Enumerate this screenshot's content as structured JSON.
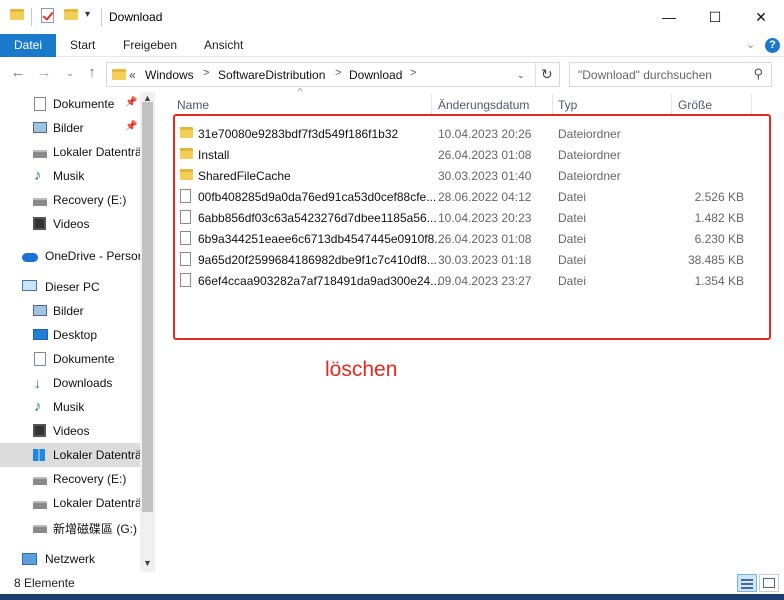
{
  "window": {
    "title": "Download",
    "controls": {
      "minimize": "—",
      "maximize": "☐",
      "close": "✕"
    }
  },
  "ribbon": {
    "tabs": [
      "Datei",
      "Start",
      "Freigeben",
      "Ansicht"
    ],
    "active_tab": "Datei"
  },
  "address": {
    "prefix": "«",
    "crumbs": [
      "Windows",
      "SoftwareDistribution",
      "Download"
    ],
    "separator": ">",
    "refresh": "↻"
  },
  "search": {
    "placeholder": "\"Download\" durchsuchen"
  },
  "sidebar": {
    "items": [
      {
        "label": "Dokumente",
        "icon": "document-icon",
        "pinned": true
      },
      {
        "label": "Bilder",
        "icon": "pictures-icon",
        "pinned": true
      },
      {
        "label": "Lokaler Datenträ",
        "icon": "drive-icon"
      },
      {
        "label": "Musik",
        "icon": "music-icon"
      },
      {
        "label": "Recovery (E:)",
        "icon": "drive-icon"
      },
      {
        "label": "Videos",
        "icon": "video-icon"
      },
      {
        "label": "OneDrive - Persor",
        "icon": "onedrive-icon"
      },
      {
        "label": "Dieser PC",
        "icon": "pc-icon"
      },
      {
        "label": "Bilder",
        "icon": "pictures-icon"
      },
      {
        "label": "Desktop",
        "icon": "desktop-icon"
      },
      {
        "label": "Dokumente",
        "icon": "document-icon"
      },
      {
        "label": "Downloads",
        "icon": "downloads-icon"
      },
      {
        "label": "Musik",
        "icon": "music-icon"
      },
      {
        "label": "Videos",
        "icon": "video-icon"
      },
      {
        "label": "Lokaler Datenträ",
        "icon": "windows-drive-icon",
        "selected": true
      },
      {
        "label": "Recovery (E:)",
        "icon": "drive-icon"
      },
      {
        "label": "Lokaler Datenträ",
        "icon": "drive-icon"
      },
      {
        "label": "新增磁碟區 (G:)",
        "icon": "drive-icon"
      },
      {
        "label": "Netzwerk",
        "icon": "network-icon"
      }
    ]
  },
  "columns": {
    "name": "Name",
    "date": "Änderungsdatum",
    "type": "Typ",
    "size": "Größe"
  },
  "files": [
    {
      "name": "31e70080e9283bdf7f3d549f186f1b32",
      "date": "10.04.2023 20:26",
      "type": "Dateiordner",
      "size": "",
      "icon": "folder-icon"
    },
    {
      "name": "Install",
      "date": "26.04.2023 01:08",
      "type": "Dateiordner",
      "size": "",
      "icon": "folder-icon"
    },
    {
      "name": "SharedFileCache",
      "date": "30.03.2023 01:40",
      "type": "Dateiordner",
      "size": "",
      "icon": "folder-icon"
    },
    {
      "name": "00fb408285d9a0da76ed91ca53d0cef88cfe...",
      "date": "28.06.2022 04:12",
      "type": "Datei",
      "size": "2.526 KB",
      "icon": "file-icon"
    },
    {
      "name": "6abb856df03c63a5423276d7dbee1185a56...",
      "date": "10.04.2023 20:23",
      "type": "Datei",
      "size": "1.482 KB",
      "icon": "file-icon"
    },
    {
      "name": "6b9a344251eaee6c6713db4547445e0910f8...",
      "date": "26.04.2023 01:08",
      "type": "Datei",
      "size": "6.230 KB",
      "icon": "file-icon"
    },
    {
      "name": "9a65d20f2599684186982dbe9f1c7c410df8...",
      "date": "30.03.2023 01:18",
      "type": "Datei",
      "size": "38.485 KB",
      "icon": "file-icon"
    },
    {
      "name": "66ef4ccaa903282a7af718491da9ad300e24...",
      "date": "09.04.2023 23:27",
      "type": "Datei",
      "size": "1.354 KB",
      "icon": "file-icon"
    }
  ],
  "annotation": {
    "text": "löschen",
    "color": "#e8291d"
  },
  "status": {
    "item_count": "8 Elemente"
  },
  "colors": {
    "accent": "#1979ca",
    "selected_bg": "#dcdcdc"
  }
}
